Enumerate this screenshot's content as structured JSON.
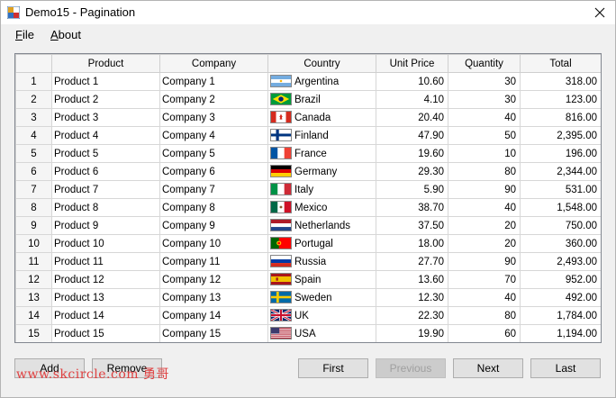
{
  "window": {
    "title": "Demo15 - Pagination"
  },
  "menu": {
    "file": "File",
    "file_mn": "F",
    "file_rest": "ile",
    "about": "About",
    "about_mn": "A",
    "about_rest": "bout"
  },
  "grid": {
    "columns": [
      "Product",
      "Company",
      "Country",
      "Unit Price",
      "Quantity",
      "Total"
    ],
    "rows": [
      {
        "n": "1",
        "product": "Product 1",
        "company": "Company 1",
        "country": "Argentina",
        "flag": "flag-argentina",
        "price": "10.60",
        "qty": "30",
        "total": "318.00"
      },
      {
        "n": "2",
        "product": "Product 2",
        "company": "Company 2",
        "country": "Brazil",
        "flag": "flag-brazil",
        "price": "4.10",
        "qty": "30",
        "total": "123.00"
      },
      {
        "n": "3",
        "product": "Product 3",
        "company": "Company 3",
        "country": "Canada",
        "flag": "flag-canada",
        "price": "20.40",
        "qty": "40",
        "total": "816.00"
      },
      {
        "n": "4",
        "product": "Product 4",
        "company": "Company 4",
        "country": "Finland",
        "flag": "flag-finland",
        "price": "47.90",
        "qty": "50",
        "total": "2,395.00"
      },
      {
        "n": "5",
        "product": "Product 5",
        "company": "Company 5",
        "country": "France",
        "flag": "flag-france",
        "price": "19.60",
        "qty": "10",
        "total": "196.00"
      },
      {
        "n": "6",
        "product": "Product 6",
        "company": "Company 6",
        "country": "Germany",
        "flag": "flag-germany",
        "price": "29.30",
        "qty": "80",
        "total": "2,344.00"
      },
      {
        "n": "7",
        "product": "Product 7",
        "company": "Company 7",
        "country": "Italy",
        "flag": "flag-italy",
        "price": "5.90",
        "qty": "90",
        "total": "531.00"
      },
      {
        "n": "8",
        "product": "Product 8",
        "company": "Company 8",
        "country": "Mexico",
        "flag": "flag-mexico",
        "price": "38.70",
        "qty": "40",
        "total": "1,548.00"
      },
      {
        "n": "9",
        "product": "Product 9",
        "company": "Company 9",
        "country": "Netherlands",
        "flag": "flag-netherlands",
        "price": "37.50",
        "qty": "20",
        "total": "750.00"
      },
      {
        "n": "10",
        "product": "Product 10",
        "company": "Company 10",
        "country": "Portugal",
        "flag": "flag-portugal",
        "price": "18.00",
        "qty": "20",
        "total": "360.00"
      },
      {
        "n": "11",
        "product": "Product 11",
        "company": "Company 11",
        "country": "Russia",
        "flag": "flag-russia",
        "price": "27.70",
        "qty": "90",
        "total": "2,493.00"
      },
      {
        "n": "12",
        "product": "Product 12",
        "company": "Company 12",
        "country": "Spain",
        "flag": "flag-spain",
        "price": "13.60",
        "qty": "70",
        "total": "952.00"
      },
      {
        "n": "13",
        "product": "Product 13",
        "company": "Company 13",
        "country": "Sweden",
        "flag": "flag-sweden",
        "price": "12.30",
        "qty": "40",
        "total": "492.00"
      },
      {
        "n": "14",
        "product": "Product 14",
        "company": "Company 14",
        "country": "UK",
        "flag": "flag-uk",
        "price": "22.30",
        "qty": "80",
        "total": "1,784.00"
      },
      {
        "n": "15",
        "product": "Product 15",
        "company": "Company 15",
        "country": "USA",
        "flag": "flag-usa",
        "price": "19.90",
        "qty": "60",
        "total": "1,194.00"
      }
    ]
  },
  "buttons": {
    "add": "Add",
    "remove": "Remove",
    "first": "First",
    "previous": "Previous",
    "next": "Next",
    "last": "Last"
  },
  "watermark": "www.skcircle.com 勇哥",
  "colors": {
    "window_bg": "#f0f0f0",
    "grid_border": "#828790",
    "disabled_text": "#a0a0a0",
    "watermark": "#e04040"
  }
}
